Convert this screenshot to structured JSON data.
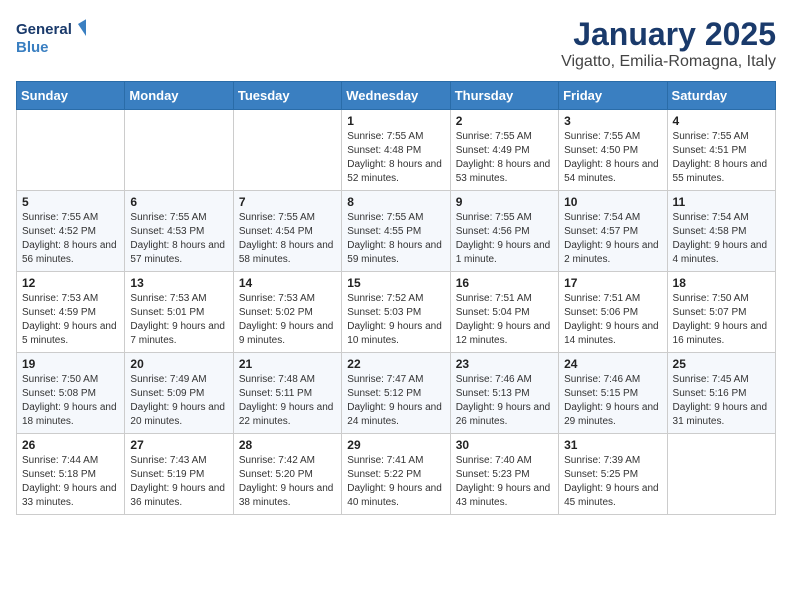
{
  "header": {
    "logo_line1": "General",
    "logo_line2": "Blue",
    "month": "January 2025",
    "location": "Vigatto, Emilia-Romagna, Italy"
  },
  "days_of_week": [
    "Sunday",
    "Monday",
    "Tuesday",
    "Wednesday",
    "Thursday",
    "Friday",
    "Saturday"
  ],
  "weeks": [
    [
      {
        "day": "",
        "info": ""
      },
      {
        "day": "",
        "info": ""
      },
      {
        "day": "",
        "info": ""
      },
      {
        "day": "1",
        "info": "Sunrise: 7:55 AM\nSunset: 4:48 PM\nDaylight: 8 hours and 52 minutes."
      },
      {
        "day": "2",
        "info": "Sunrise: 7:55 AM\nSunset: 4:49 PM\nDaylight: 8 hours and 53 minutes."
      },
      {
        "day": "3",
        "info": "Sunrise: 7:55 AM\nSunset: 4:50 PM\nDaylight: 8 hours and 54 minutes."
      },
      {
        "day": "4",
        "info": "Sunrise: 7:55 AM\nSunset: 4:51 PM\nDaylight: 8 hours and 55 minutes."
      }
    ],
    [
      {
        "day": "5",
        "info": "Sunrise: 7:55 AM\nSunset: 4:52 PM\nDaylight: 8 hours and 56 minutes."
      },
      {
        "day": "6",
        "info": "Sunrise: 7:55 AM\nSunset: 4:53 PM\nDaylight: 8 hours and 57 minutes."
      },
      {
        "day": "7",
        "info": "Sunrise: 7:55 AM\nSunset: 4:54 PM\nDaylight: 8 hours and 58 minutes."
      },
      {
        "day": "8",
        "info": "Sunrise: 7:55 AM\nSunset: 4:55 PM\nDaylight: 8 hours and 59 minutes."
      },
      {
        "day": "9",
        "info": "Sunrise: 7:55 AM\nSunset: 4:56 PM\nDaylight: 9 hours and 1 minute."
      },
      {
        "day": "10",
        "info": "Sunrise: 7:54 AM\nSunset: 4:57 PM\nDaylight: 9 hours and 2 minutes."
      },
      {
        "day": "11",
        "info": "Sunrise: 7:54 AM\nSunset: 4:58 PM\nDaylight: 9 hours and 4 minutes."
      }
    ],
    [
      {
        "day": "12",
        "info": "Sunrise: 7:53 AM\nSunset: 4:59 PM\nDaylight: 9 hours and 5 minutes."
      },
      {
        "day": "13",
        "info": "Sunrise: 7:53 AM\nSunset: 5:01 PM\nDaylight: 9 hours and 7 minutes."
      },
      {
        "day": "14",
        "info": "Sunrise: 7:53 AM\nSunset: 5:02 PM\nDaylight: 9 hours and 9 minutes."
      },
      {
        "day": "15",
        "info": "Sunrise: 7:52 AM\nSunset: 5:03 PM\nDaylight: 9 hours and 10 minutes."
      },
      {
        "day": "16",
        "info": "Sunrise: 7:51 AM\nSunset: 5:04 PM\nDaylight: 9 hours and 12 minutes."
      },
      {
        "day": "17",
        "info": "Sunrise: 7:51 AM\nSunset: 5:06 PM\nDaylight: 9 hours and 14 minutes."
      },
      {
        "day": "18",
        "info": "Sunrise: 7:50 AM\nSunset: 5:07 PM\nDaylight: 9 hours and 16 minutes."
      }
    ],
    [
      {
        "day": "19",
        "info": "Sunrise: 7:50 AM\nSunset: 5:08 PM\nDaylight: 9 hours and 18 minutes."
      },
      {
        "day": "20",
        "info": "Sunrise: 7:49 AM\nSunset: 5:09 PM\nDaylight: 9 hours and 20 minutes."
      },
      {
        "day": "21",
        "info": "Sunrise: 7:48 AM\nSunset: 5:11 PM\nDaylight: 9 hours and 22 minutes."
      },
      {
        "day": "22",
        "info": "Sunrise: 7:47 AM\nSunset: 5:12 PM\nDaylight: 9 hours and 24 minutes."
      },
      {
        "day": "23",
        "info": "Sunrise: 7:46 AM\nSunset: 5:13 PM\nDaylight: 9 hours and 26 minutes."
      },
      {
        "day": "24",
        "info": "Sunrise: 7:46 AM\nSunset: 5:15 PM\nDaylight: 9 hours and 29 minutes."
      },
      {
        "day": "25",
        "info": "Sunrise: 7:45 AM\nSunset: 5:16 PM\nDaylight: 9 hours and 31 minutes."
      }
    ],
    [
      {
        "day": "26",
        "info": "Sunrise: 7:44 AM\nSunset: 5:18 PM\nDaylight: 9 hours and 33 minutes."
      },
      {
        "day": "27",
        "info": "Sunrise: 7:43 AM\nSunset: 5:19 PM\nDaylight: 9 hours and 36 minutes."
      },
      {
        "day": "28",
        "info": "Sunrise: 7:42 AM\nSunset: 5:20 PM\nDaylight: 9 hours and 38 minutes."
      },
      {
        "day": "29",
        "info": "Sunrise: 7:41 AM\nSunset: 5:22 PM\nDaylight: 9 hours and 40 minutes."
      },
      {
        "day": "30",
        "info": "Sunrise: 7:40 AM\nSunset: 5:23 PM\nDaylight: 9 hours and 43 minutes."
      },
      {
        "day": "31",
        "info": "Sunrise: 7:39 AM\nSunset: 5:25 PM\nDaylight: 9 hours and 45 minutes."
      },
      {
        "day": "",
        "info": ""
      }
    ]
  ]
}
